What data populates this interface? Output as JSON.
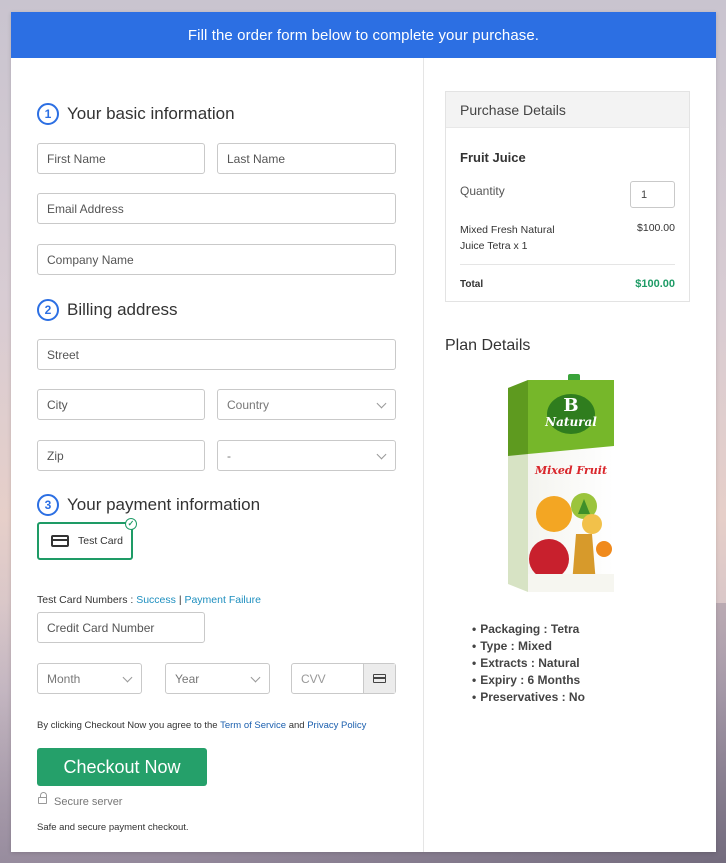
{
  "banner": {
    "text": "Fill the order form below to complete your purchase."
  },
  "sections": {
    "basic": {
      "num": "1",
      "title": "Your basic information"
    },
    "billing": {
      "num": "2",
      "title": "Billing address"
    },
    "payment": {
      "num": "3",
      "title": "Your payment information"
    }
  },
  "fields": {
    "first_name": "First Name",
    "last_name": "Last Name",
    "email": "Email Address",
    "company": "Company Name",
    "street": "Street",
    "city": "City",
    "country": "Country",
    "zip": "Zip",
    "state": "-",
    "card_number": "Credit Card Number",
    "month": "Month",
    "year": "Year",
    "cvv": "CVV"
  },
  "payment": {
    "test_card_label": "Test Card",
    "test_numbers_prefix": "Test Card Numbers :",
    "success_link": "Success",
    "separator": "|",
    "failure_link": "Payment Failure"
  },
  "terms": {
    "prefix": "By clicking Checkout Now you agree to the",
    "tos": "Term of Service",
    "and": "and",
    "privacy": "Privacy Policy"
  },
  "checkout": {
    "button": "Checkout Now",
    "secure_server": "Secure server",
    "secure_note": "Safe and secure payment checkout."
  },
  "purchase": {
    "header": "Purchase Details",
    "product": "Fruit Juice",
    "quantity_label": "Quantity",
    "quantity_value": "1",
    "item_line1": "Mixed Fresh Natural",
    "item_line2": "Juice Tetra x 1",
    "item_price": "$100.00",
    "total_label": "Total",
    "total_value": "$100.00"
  },
  "plan": {
    "title": "Plan Details",
    "features": [
      "Packaging : Tetra",
      "Type : Mixed",
      "Extracts : Natural",
      "Expiry : 6 Months",
      "Preservatives : No"
    ]
  },
  "product_image": {
    "brand": "Natural",
    "flavor": "Mixed Fruit"
  },
  "colors": {
    "banner": "#2c6fe3",
    "checkout": "#25a06a",
    "total": "#1e9b66",
    "link": "#1e8fbf"
  }
}
